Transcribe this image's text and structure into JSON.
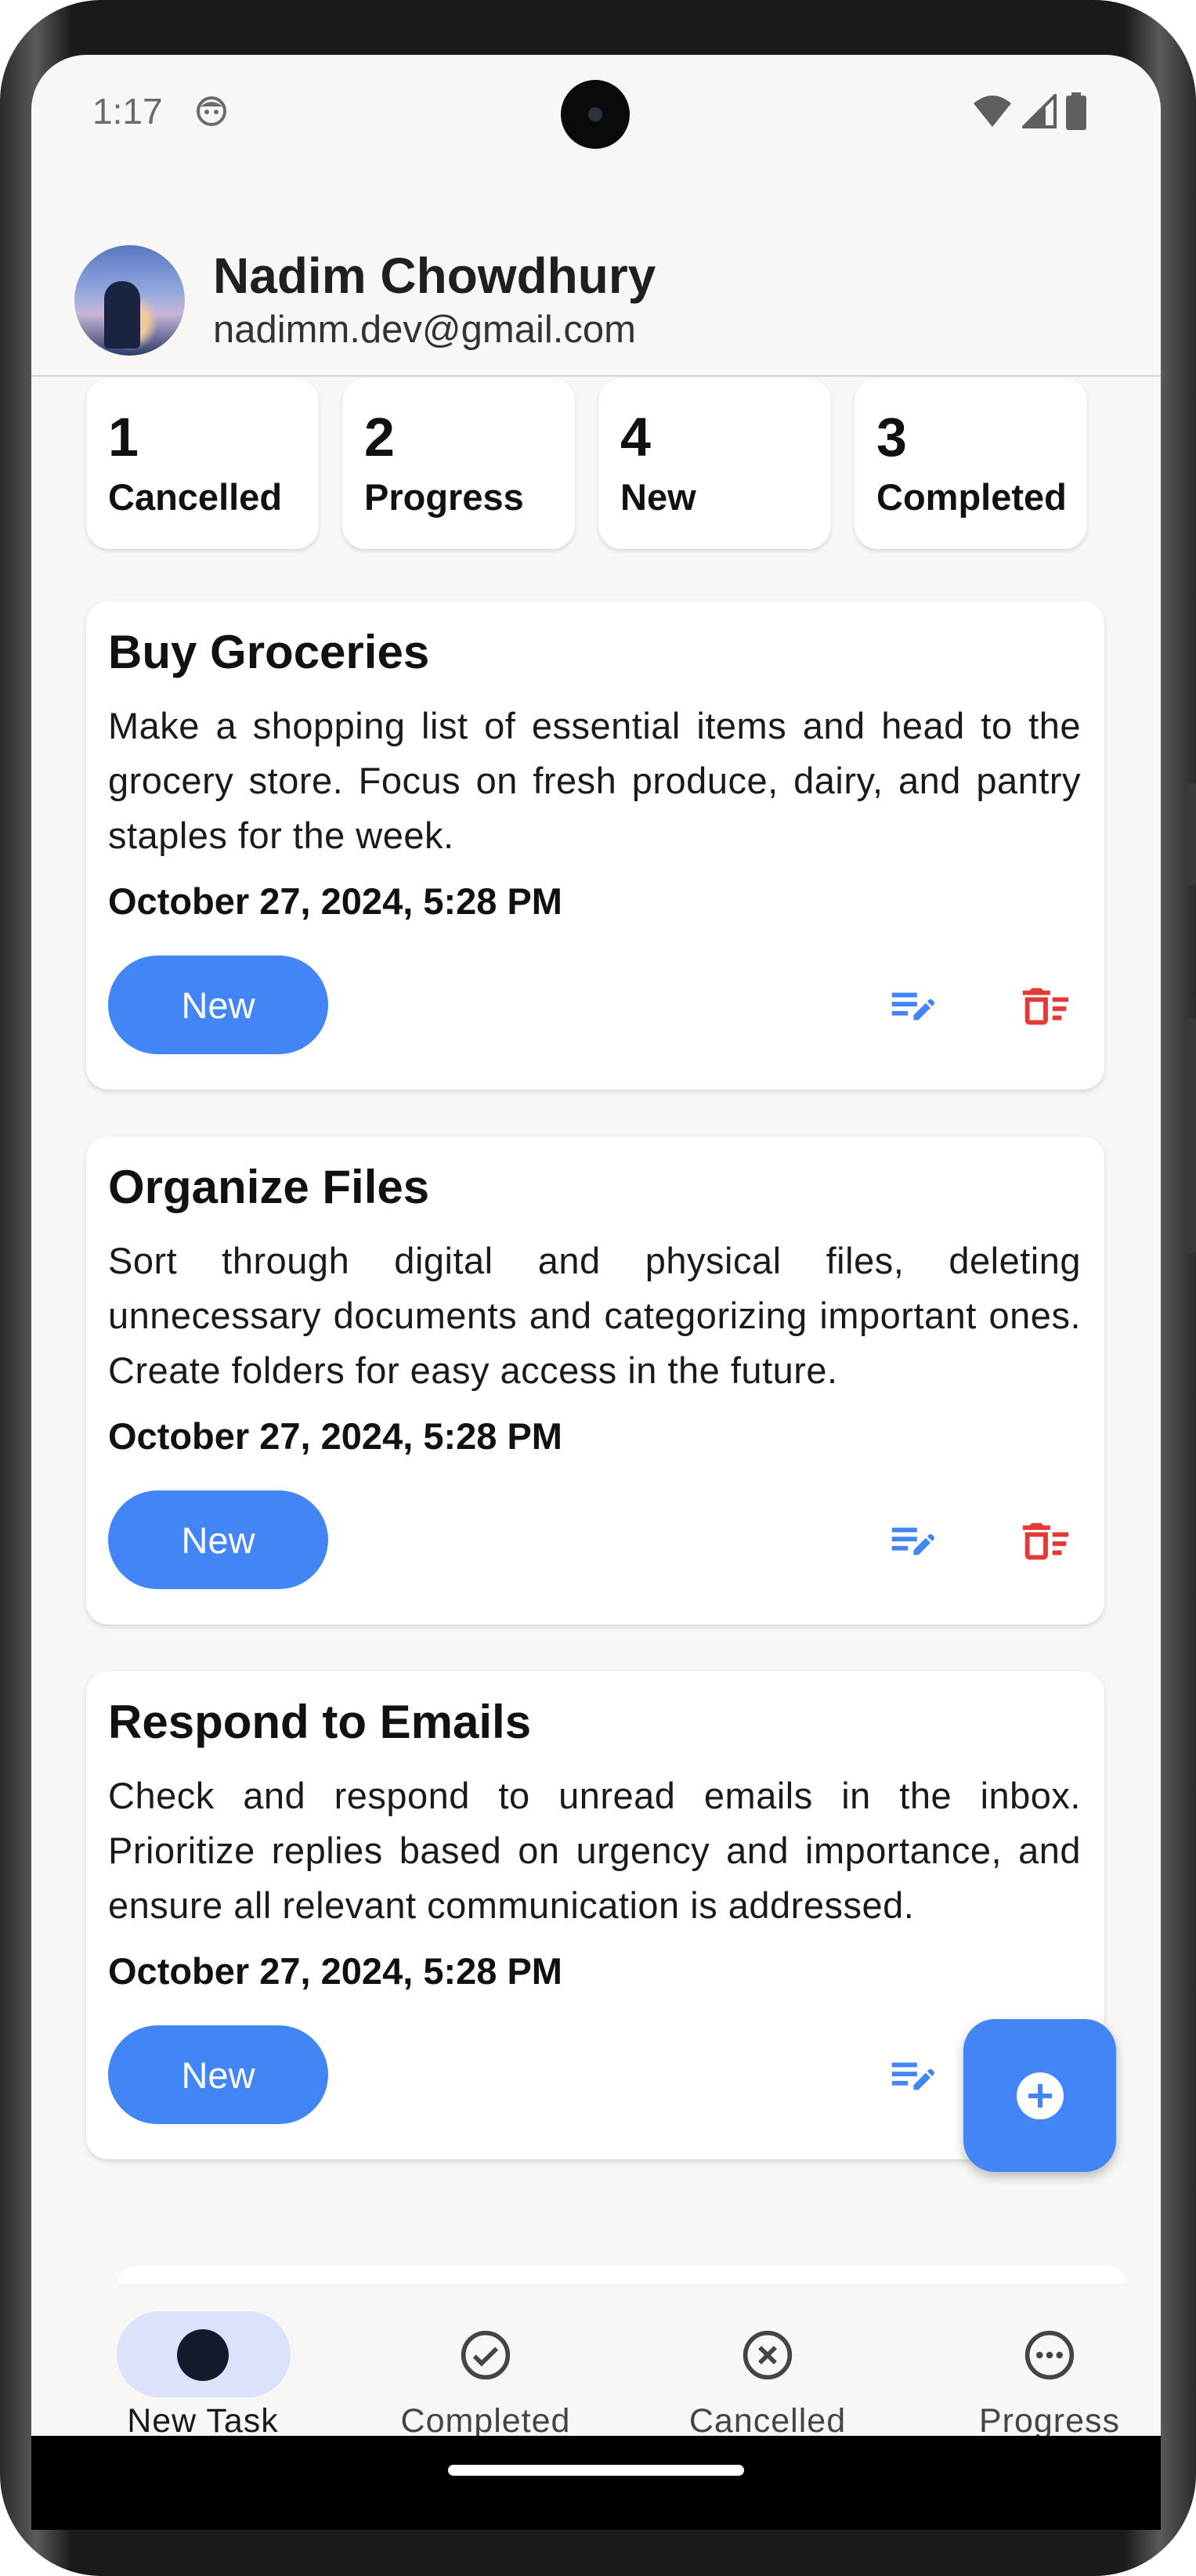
{
  "status_bar": {
    "time": "1:17"
  },
  "user": {
    "name": "Nadim Chowdhury",
    "email": "nadimm.dev@gmail.com"
  },
  "summary": [
    {
      "count": "1",
      "label": "Cancelled"
    },
    {
      "count": "2",
      "label": "Progress"
    },
    {
      "count": "4",
      "label": "New"
    },
    {
      "count": "3",
      "label": "Completed"
    }
  ],
  "tasks": [
    {
      "title": "Buy Groceries",
      "description": "Make a shopping list of essential items and head to the grocery store. Focus on fresh produce, dairy, and pantry staples for the week.",
      "date": "October 27, 2024, 5:28 PM",
      "status": "New"
    },
    {
      "title": "Organize Files",
      "description": "Sort through digital and physical files, deleting unnecessary documents and categorizing important ones. Create folders for easy access in the future.",
      "date": "October 27, 2024, 5:28 PM",
      "status": "New"
    },
    {
      "title": "Respond to Emails",
      "description": "Check and respond to unread emails in the inbox. Prioritize replies based on urgency and importance, and ensure all relevant communication is addressed.",
      "date": "October 27, 2024, 5:28 PM",
      "status": "New"
    }
  ],
  "bottom_nav": [
    {
      "label": "New Task",
      "icon": "filled-circle-icon",
      "active": true
    },
    {
      "label": "Completed",
      "icon": "check-circle-icon",
      "active": false
    },
    {
      "label": "Cancelled",
      "icon": "x-circle-icon",
      "active": false
    },
    {
      "label": "Progress",
      "icon": "more-circle-icon",
      "active": false
    }
  ],
  "fab": {
    "icon": "add-circle-icon"
  },
  "colors": {
    "accent": "#4285f4",
    "delete": "#e53935",
    "background": "#f8f7f5",
    "nav_indicator": "#dbe2fb"
  }
}
